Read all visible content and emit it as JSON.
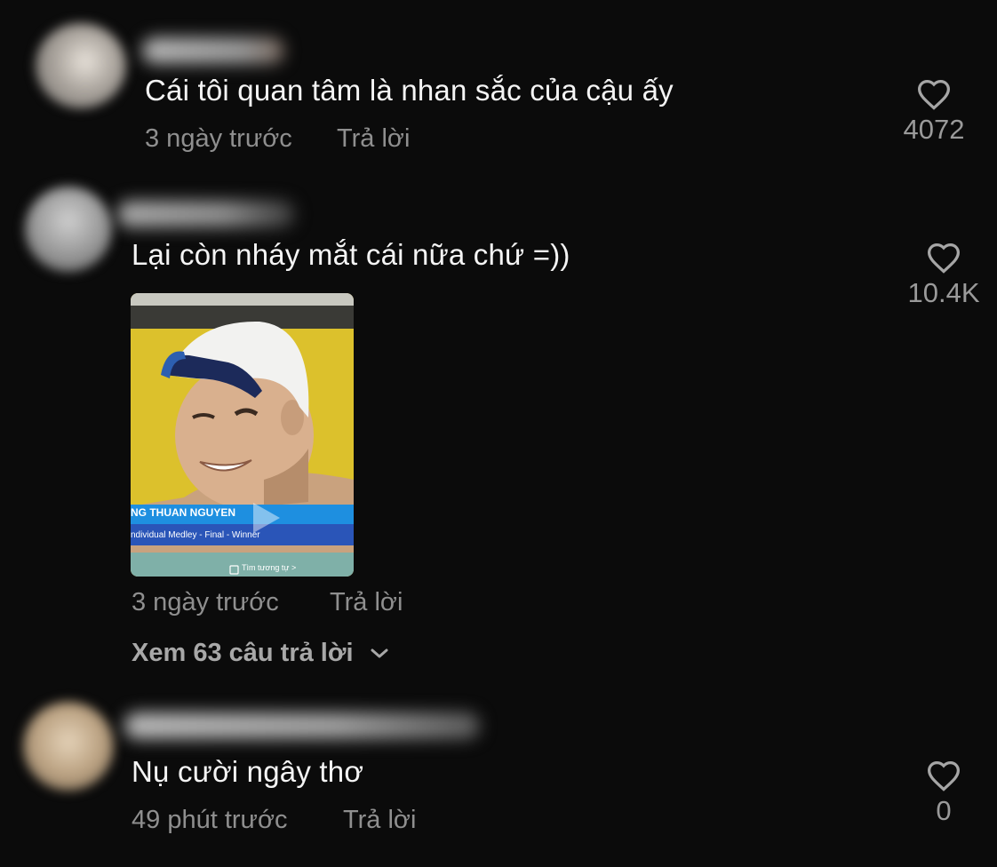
{
  "comments": [
    {
      "text": "Cái tôi quan tâm là nhan sắc của cậu ấy",
      "time": "3 ngày trước",
      "reply_label": "Trả lời",
      "likes": "4072"
    },
    {
      "text": "Lại còn nháy mắt cái nữa chứ =))",
      "time": "3 ngày trước",
      "reply_label": "Trả lời",
      "likes": "10.4K",
      "attachment": {
        "banner_name": "NG THUAN NGUYEN",
        "banner_event": "ndividual Medley  - Final - Winner",
        "similar_label": "Tìm tương tự >"
      },
      "view_replies": "Xem 63 câu trả lời"
    },
    {
      "text": "Nụ cười ngây thơ",
      "time": "49 phút trước",
      "reply_label": "Trả lời",
      "likes": "0"
    }
  ],
  "icons": {
    "like": "heart-outline-icon",
    "expand": "chevron-down-icon",
    "play": "play-icon",
    "similar": "scan-icon"
  },
  "colors": {
    "background": "#0b0b0b",
    "text": "#f4f4f4",
    "muted": "#8f8f8f"
  }
}
